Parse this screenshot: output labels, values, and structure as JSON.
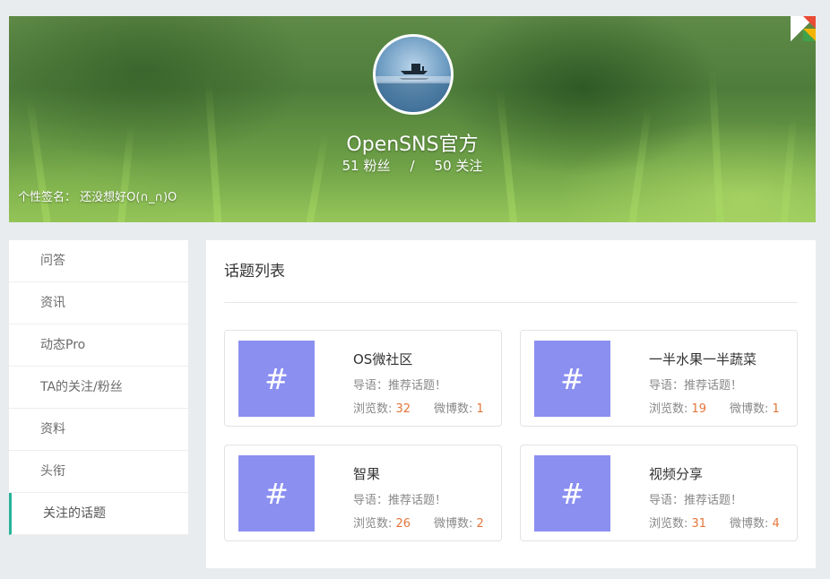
{
  "profile": {
    "name": "OpenSNS官方",
    "fans_count": "51",
    "fans_label": "粉丝",
    "stats_separator": "/",
    "follow_count": "50",
    "follow_label": "关注",
    "signature": "个性签名： 还没想好O(∩_∩)O"
  },
  "sidebar": {
    "items": [
      {
        "label": "问答"
      },
      {
        "label": "资讯"
      },
      {
        "label": "动态Pro"
      },
      {
        "label": "TA的关注/粉丝"
      },
      {
        "label": "资料"
      },
      {
        "label": "头衔"
      },
      {
        "label": "关注的话题"
      }
    ],
    "active_index": 6,
    "accent_color": "#27b29a"
  },
  "main": {
    "title": "话题列表",
    "topics": [
      {
        "icon": "#",
        "name": "OS微社区",
        "intro": "导语：推荐话题！",
        "views_label": "浏览数:",
        "views": "32",
        "posts_label": "微博数:",
        "posts": "1"
      },
      {
        "icon": "#",
        "name": "一半水果一半蔬菜",
        "intro": "导语：推荐话题！",
        "views_label": "浏览数:",
        "views": "19",
        "posts_label": "微博数:",
        "posts": "1"
      },
      {
        "icon": "#",
        "name": "智果",
        "intro": "导语：推荐话题！",
        "views_label": "浏览数:",
        "views": "26",
        "posts_label": "微博数:",
        "posts": "2"
      },
      {
        "icon": "#",
        "name": "视频分享",
        "intro": "导语：推荐话题！",
        "views_label": "浏览数:",
        "views": "31",
        "posts_label": "微博数:",
        "posts": "4"
      }
    ],
    "thumb_color": "#8b8ff0",
    "count_color": "#e5763a"
  }
}
